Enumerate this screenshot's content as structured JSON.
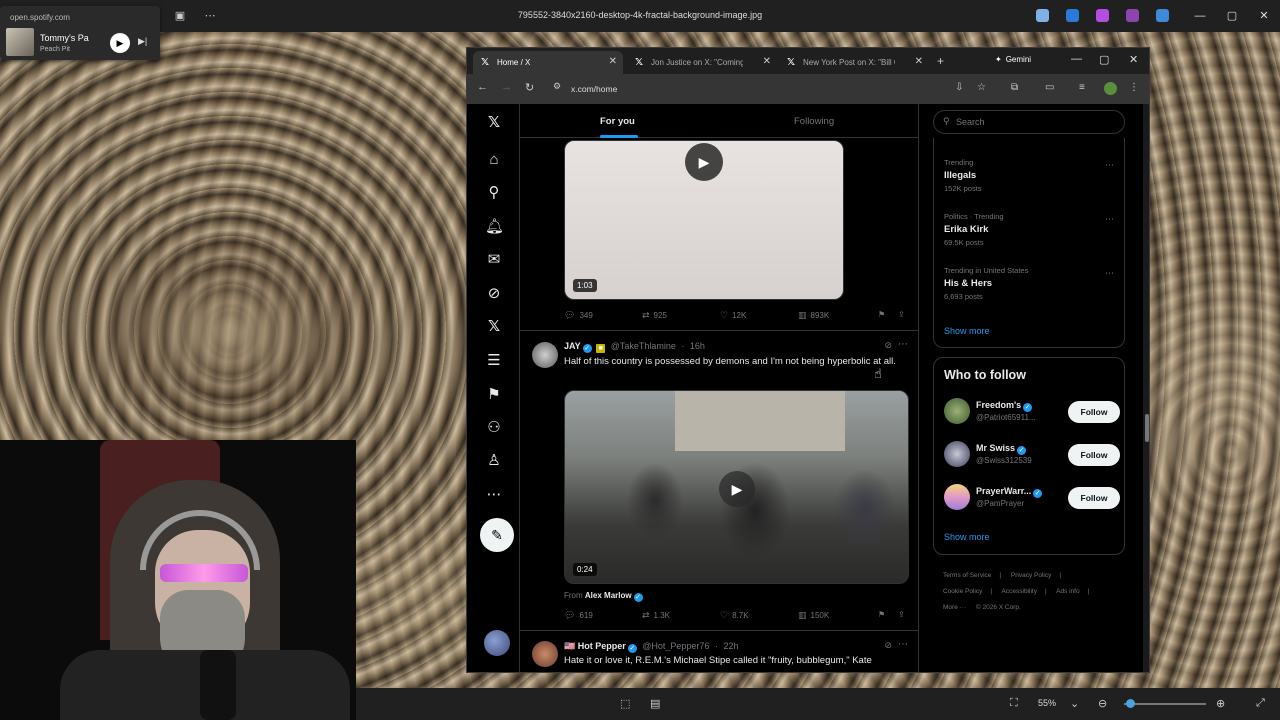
{
  "viewer": {
    "title": "795552-3840x2160-desktop-4k-fractal-background-image.jpg",
    "zoom": "55%"
  },
  "spotify": {
    "url": "open.spotify.com",
    "track": "Tommy's Pa",
    "artist": "Peach Pit"
  },
  "browser": {
    "tabs": [
      {
        "label": "Home / X",
        "active": true
      },
      {
        "label": "Jon Justice on X: \"Coming up",
        "active": false
      },
      {
        "label": "New York Post on X: \"Bill Gat",
        "active": false
      }
    ],
    "gemini_label": "Gemini",
    "url": "x.com/home"
  },
  "timeline": {
    "tab_for_you": "For you",
    "tab_following": "Following",
    "video1": {
      "duration": "1:03",
      "stats": {
        "replies": "349",
        "reposts": "925",
        "likes": "12K",
        "views": "893K"
      }
    },
    "tweet2": {
      "name": "JAY",
      "handle": "@TakeThlamine",
      "time": "16h",
      "text": "Half of this country is possessed by demons and I'm not being hyperbolic at all.",
      "video_duration": "0:24",
      "from_prefix": "From",
      "from_name": "Alex Marlow",
      "stats": {
        "replies": "619",
        "reposts": "1.3K",
        "likes": "8.7K",
        "views": "150K"
      }
    },
    "tweet3": {
      "name": "Hot Pepper",
      "handle": "@Hot_Pepper76",
      "time": "22h",
      "text": "Hate it or love it, R.E.M.'s Michael Stipe called it \"fruity, bubblegum,\" Kate"
    }
  },
  "sidebar": {
    "search_placeholder": "Search",
    "trends": [
      {
        "category": "Trending",
        "name": "Illegals",
        "posts": "152K posts"
      },
      {
        "category": "Politics · Trending",
        "name": "Erika Kirk",
        "posts": "69.5K posts"
      },
      {
        "category": "Trending in United States",
        "name": "His & Hers",
        "posts": "6,693 posts"
      }
    ],
    "show_more": "Show more",
    "who_to_follow": {
      "title": "Who to follow",
      "people": [
        {
          "name": "Freedom's",
          "handle": "@Patriot65911...",
          "button": "Follow"
        },
        {
          "name": "Mr Swiss",
          "handle": "@Swiss312539",
          "button": "Follow"
        },
        {
          "name": "PrayerWarr...",
          "handle": "@PamPrayer",
          "button": "Follow"
        }
      ],
      "show_more": "Show more"
    },
    "footer": [
      "Terms of Service",
      "Privacy Policy",
      "Cookie Policy",
      "Accessibility",
      "Ads info",
      "More ···",
      "© 2026 X Corp."
    ]
  },
  "colors": {
    "accent": "#1d9bf0",
    "background": "#000000",
    "text_primary": "#e7e9ea",
    "text_secondary": "#71767b"
  }
}
